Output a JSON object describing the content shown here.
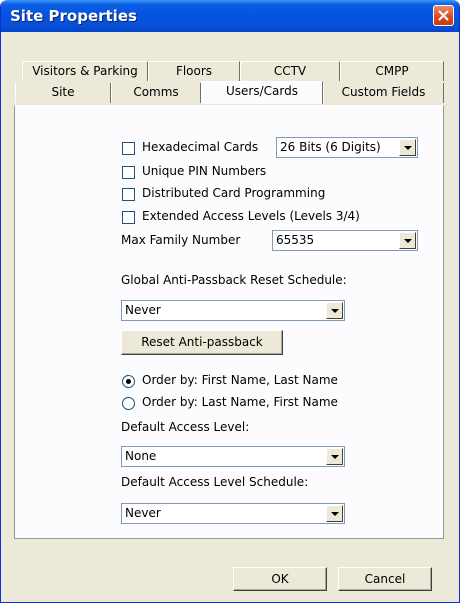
{
  "window": {
    "title": "Site Properties"
  },
  "tabs": {
    "row1": [
      "Visitors & Parking",
      "Floors",
      "CCTV",
      "CMPP"
    ],
    "row2": [
      "Site",
      "Comms",
      "Users/Cards",
      "Custom Fields"
    ],
    "active": "Users/Cards"
  },
  "users_cards": {
    "hex_cards_label": "Hexadecimal Cards",
    "hex_cards_checked": false,
    "card_bits_value": "26 Bits (6 Digits)",
    "unique_pin_label": "Unique PIN Numbers",
    "unique_pin_checked": false,
    "distributed_label": "Distributed Card Programming",
    "distributed_checked": false,
    "extended_label": "Extended Access Levels (Levels 3/4)",
    "extended_checked": false,
    "max_family_label": "Max Family Number",
    "max_family_value": "65535",
    "anti_passback_label": "Global Anti-Passback Reset Schedule:",
    "anti_passback_value": "Never",
    "reset_button": "Reset Anti-passback",
    "order_first_label": "Order by: First Name, Last Name",
    "order_first_checked": true,
    "order_last_label": "Order by: Last Name, First Name",
    "order_last_checked": false,
    "default_level_label": "Default Access Level:",
    "default_level_value": "None",
    "default_schedule_label": "Default Access Level Schedule:",
    "default_schedule_value": "Never"
  },
  "footer": {
    "ok": "OK",
    "cancel": "Cancel"
  },
  "colors": {
    "titlebar": "#0554e3",
    "close": "#d54b1e",
    "dialog_bg": "#ece9d8"
  }
}
